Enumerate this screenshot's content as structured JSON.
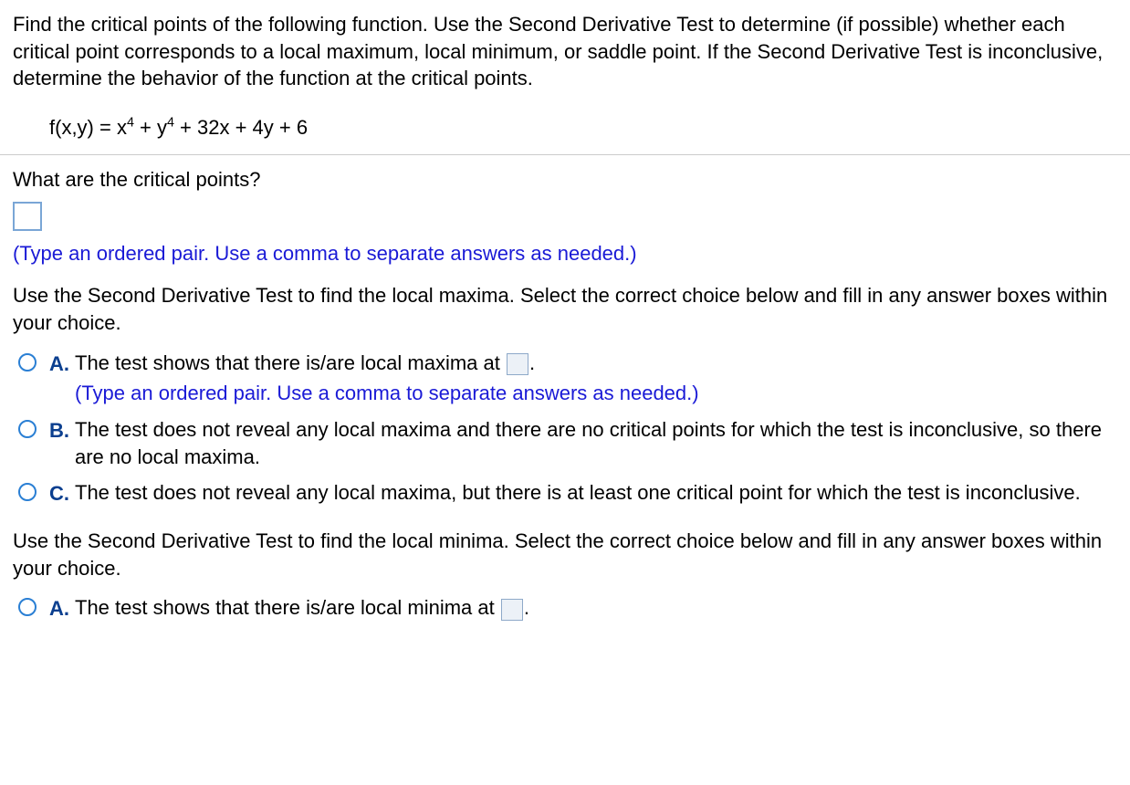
{
  "intro": "Find the critical points of the following function. Use the Second Derivative Test to determine (if possible) whether each critical point corresponds to a local maximum, local minimum, or saddle point. If the Second Derivative Test is inconclusive, determine the behavior of the function at the critical points.",
  "formula": {
    "lhs": "f(x,y) = x",
    "exp1": "4",
    "plus_y": " + y",
    "exp2": "4",
    "tail": " + 32x + 4y + 6"
  },
  "q1": {
    "prompt": "What are the critical points?",
    "hint": "(Type an ordered pair. Use a comma to separate answers as needed.)"
  },
  "maxima": {
    "instruction": "Use the Second Derivative Test to find the local maxima. Select the correct choice below and fill in any answer boxes within your choice.",
    "A_pre": "The test shows that there is/are local maxima at ",
    "A_post": ".",
    "A_hint": "(Type an ordered pair. Use a comma to separate answers as needed.)",
    "B": "The test does not reveal any local maxima and there are no critical points for which the test is inconclusive, so there are no local maxima.",
    "C": "The test does not reveal any local maxima, but there is at least one critical point for which the test is inconclusive."
  },
  "minima": {
    "instruction": "Use the Second Derivative Test to find the local minima. Select the correct choice below and fill in any answer boxes within your choice.",
    "A_pre": "The test shows that there is/are local minima at ",
    "A_post": "."
  },
  "letters": {
    "A": "A.",
    "B": "B.",
    "C": "C."
  }
}
